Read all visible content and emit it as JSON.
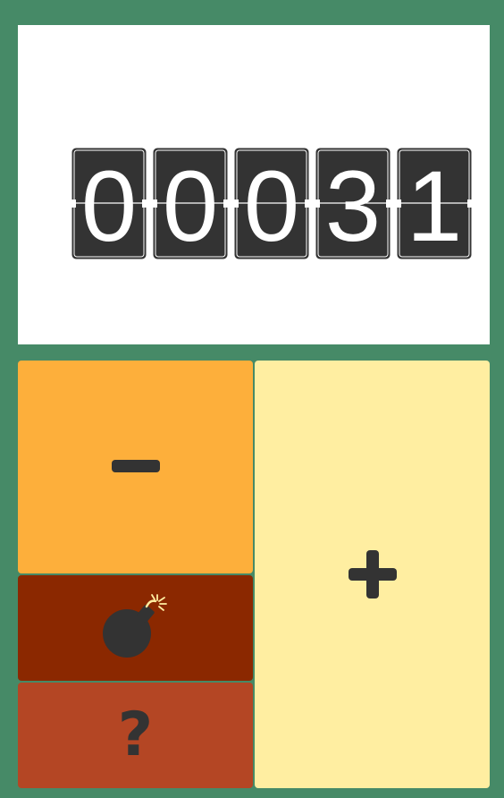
{
  "counter": {
    "digits": [
      "0",
      "0",
      "0",
      "3",
      "1"
    ]
  },
  "buttons": {
    "decrement": {
      "icon": "minus-icon"
    },
    "bomb": {
      "icon": "bomb-icon"
    },
    "help": {
      "label": "?"
    },
    "increment": {
      "icon": "plus-icon"
    }
  },
  "colors": {
    "background": "#468a67",
    "display_panel": "#ffffff",
    "digit_card": "#333333",
    "digit_text": "#ffffff",
    "decrement_button": "#fdaf3b",
    "bomb_button": "#8b2800",
    "help_button": "#b44624",
    "increment_button": "#ffeea1",
    "icon": "#333333"
  }
}
